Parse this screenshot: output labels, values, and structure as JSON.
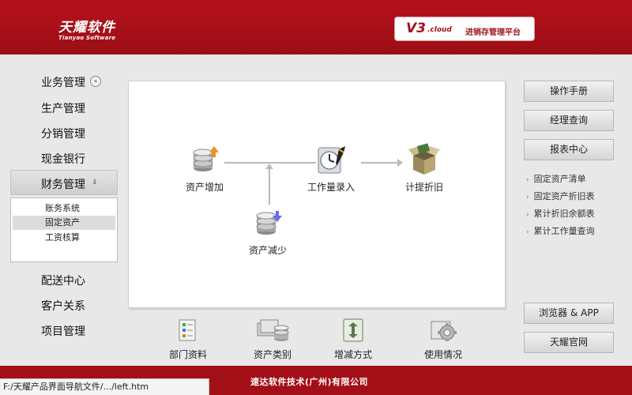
{
  "header": {
    "logo_cn": "天耀软件",
    "logo_en": "Tianyao Software",
    "version": "V3",
    "version_suffix": ".cloud",
    "platform": "进销存管理平台",
    "colors": {
      "brand_red": "#a30f17"
    }
  },
  "nav": {
    "items": [
      {
        "label": "业务管理",
        "icon": "chevron-down-circle-icon"
      },
      {
        "label": "生产管理"
      },
      {
        "label": "分销管理"
      },
      {
        "label": "现金银行"
      },
      {
        "label": "财务管理",
        "icon": "chevron-down-icon",
        "active": true
      },
      {
        "label": "配送中心"
      },
      {
        "label": "客户关系"
      },
      {
        "label": "项目管理"
      }
    ],
    "sub_items": [
      {
        "label": "账务系统"
      },
      {
        "label": "固定资产",
        "selected": true
      },
      {
        "label": "工资核算"
      }
    ]
  },
  "flow": {
    "asset_add": "资产增加",
    "workload_entry": "工作量录入",
    "depreciation": "计提折旧",
    "asset_reduce": "资产减少"
  },
  "tools": {
    "department": "部门资料",
    "asset_category": "资产类别",
    "change_method": "增减方式",
    "usage": "使用情况"
  },
  "right": {
    "buttons": {
      "manual": "操作手册",
      "manager_query": "经理查询",
      "report_center": "报表中心",
      "browser_app": "浏览器 & APP",
      "official_site": "天耀官网"
    },
    "links": [
      "固定资产清单",
      "固定资产折旧表",
      "累计折旧余额表",
      "累计工作量查询"
    ]
  },
  "footer": {
    "company": "速达软件技术(广州)有限公司",
    "status_url": "F:/天耀产品界面导航文件/.../left.htm"
  }
}
